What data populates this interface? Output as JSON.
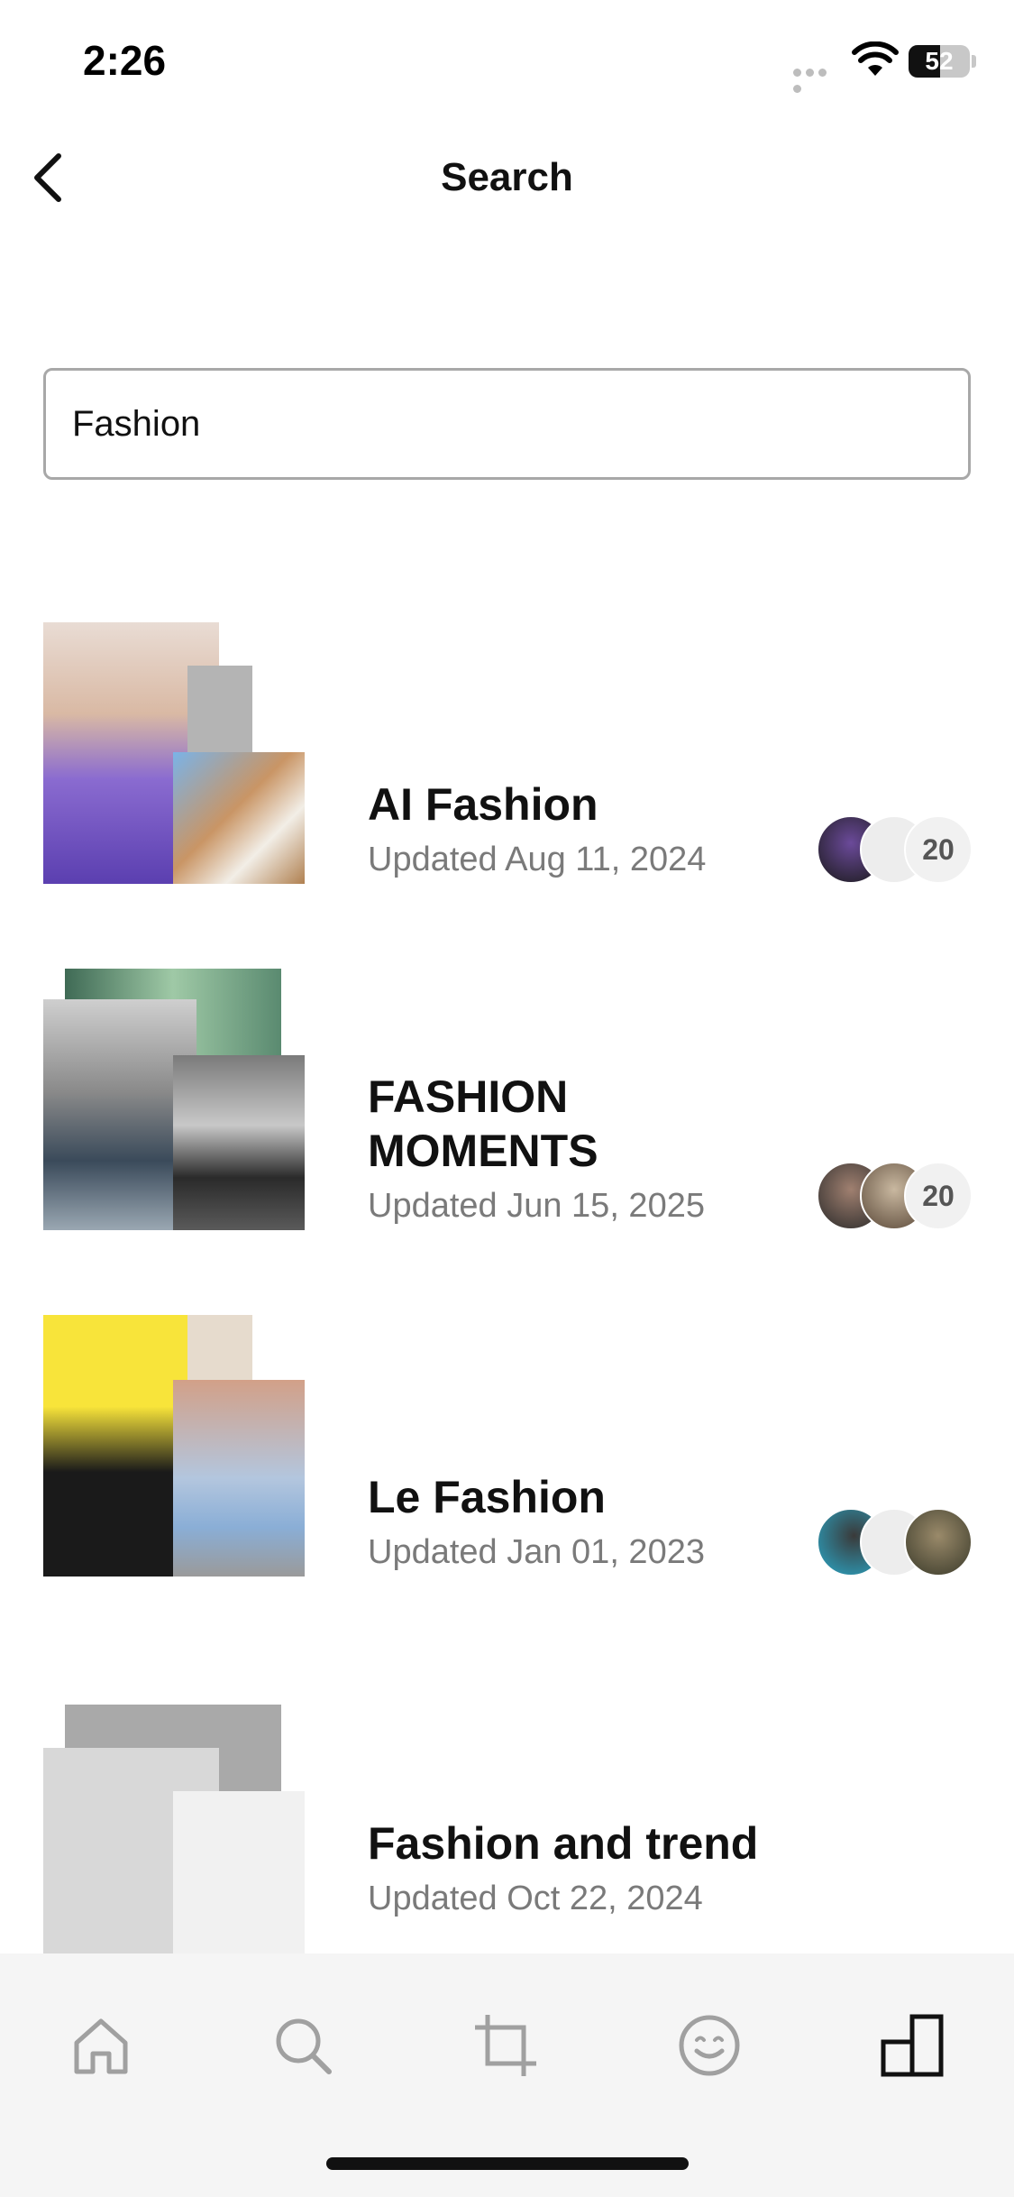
{
  "status_bar": {
    "time": "2:26",
    "battery": "52",
    "battery_level": 0.52
  },
  "header": {
    "title": "Search",
    "back_icon": "chevron-left-icon"
  },
  "search": {
    "value": "Fashion"
  },
  "results": [
    {
      "title": "AI Fashion",
      "updated": "Updated Aug 11, 2024",
      "collaborator_count": "20"
    },
    {
      "title": "FASHION MOMENTS",
      "updated": "Updated Jun 15, 2025",
      "collaborator_count": "20"
    },
    {
      "title": "Le Fashion",
      "updated": "Updated Jan 01, 2023"
    },
    {
      "title": "Fashion and trend",
      "updated": "Updated Oct 22, 2024"
    }
  ],
  "tab_bar": {
    "tabs": [
      "home-icon",
      "search-icon",
      "crop-icon",
      "smiley-icon",
      "boards-icon"
    ],
    "active": "boards-icon"
  },
  "colors": {
    "accent_yellow": "#f8e43a",
    "text_secondary": "#7a7a7a",
    "tab_icon": "#a0a0a0",
    "tab_icon_active": "#111111"
  }
}
